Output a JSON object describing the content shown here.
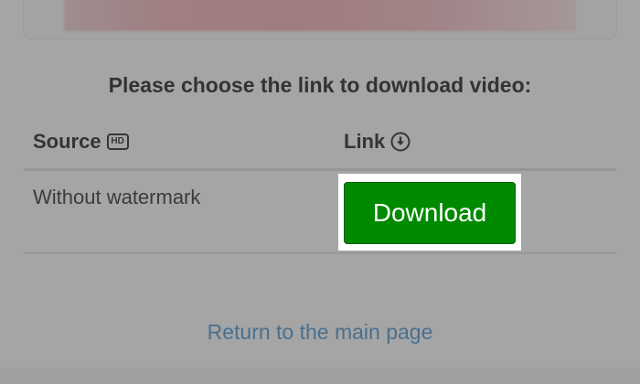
{
  "prompt": "Please choose the link to download video:",
  "table": {
    "headers": {
      "source": "Source",
      "source_badge": "HD",
      "link": "Link"
    },
    "rows": [
      {
        "source": "Without watermark",
        "action_label": "Download"
      }
    ]
  },
  "return_link": "Return to the main page",
  "colors": {
    "download_button": "#008a00",
    "link": "#4a6f8e",
    "overlay": "#a5a5a5"
  },
  "icons": {
    "hd": "hd-icon",
    "link": "download-circle-icon"
  }
}
